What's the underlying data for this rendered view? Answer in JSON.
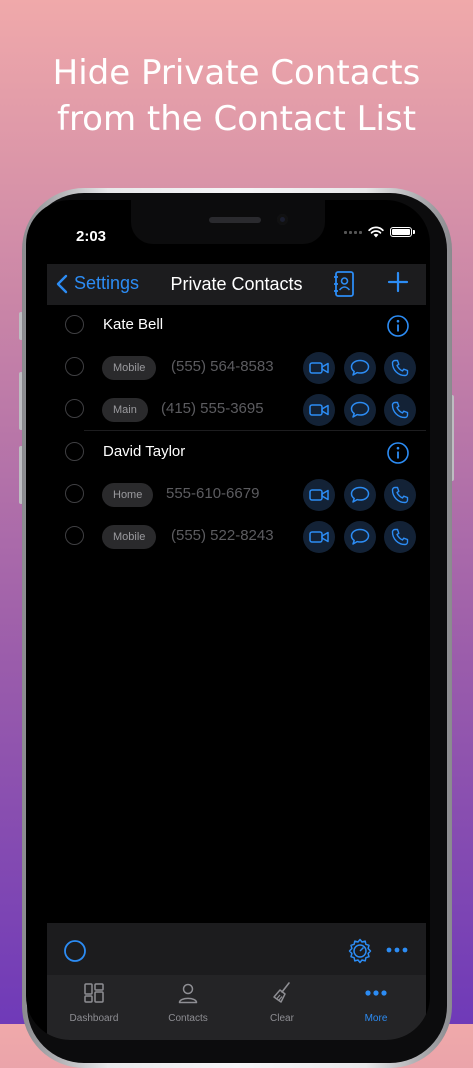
{
  "headline": {
    "line1": "Hide Private Contacts",
    "line2": "from the Contact List"
  },
  "status": {
    "time": "2:03"
  },
  "nav": {
    "back_label": "Settings",
    "title": "Private Contacts"
  },
  "contacts": [
    {
      "name": "Kate Bell",
      "numbers": [
        {
          "label": "Mobile",
          "number": "(555) 564-8583"
        },
        {
          "label": "Main",
          "number": "(415) 555-3695"
        }
      ]
    },
    {
      "name": "David Taylor",
      "numbers": [
        {
          "label": "Home",
          "number": "555-610-6679"
        },
        {
          "label": "Mobile",
          "number": "(555) 522-8243"
        }
      ]
    }
  ],
  "tabs": [
    {
      "label": "Dashboard",
      "icon": "dashboard-icon",
      "active": false
    },
    {
      "label": "Contacts",
      "icon": "person-icon",
      "active": false
    },
    {
      "label": "Clear",
      "icon": "broom-icon",
      "active": false
    },
    {
      "label": "More",
      "icon": "more-icon",
      "active": true
    }
  ],
  "colors": {
    "accent": "#2c8cf4",
    "background": "#000000",
    "bar": "#1c1c1e"
  }
}
